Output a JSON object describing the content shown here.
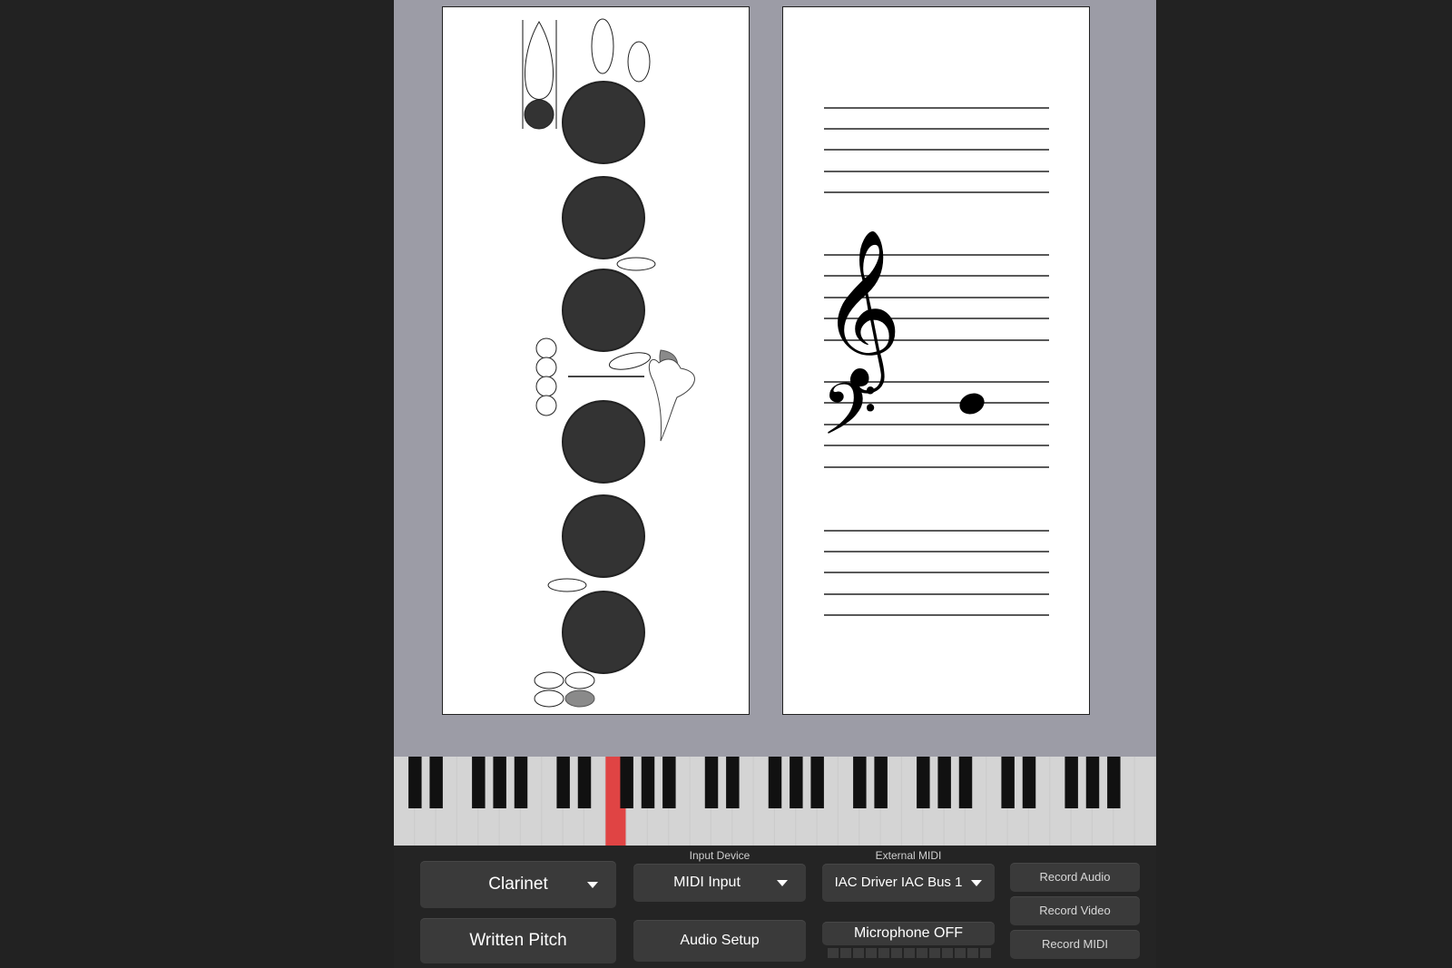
{
  "colors": {
    "app_background": "#9c9ca6",
    "key_fill_closed": "#333333",
    "key_fill_half": "#8a8a8a",
    "active_piano_key": "#e04444",
    "controls_background": "#242424",
    "button_background": "#3a3a3a"
  },
  "fingering": {
    "instrument": "Clarinet",
    "closed_keys": [
      "thumb-hole",
      "hole-1",
      "hole-2",
      "hole-3",
      "hole-4",
      "hole-5",
      "hole-6"
    ],
    "half_keys": [
      "side-key-upper",
      "pinky-key-bottom-right"
    ]
  },
  "staff": {
    "clefs": [
      "treble-clef-icon",
      "bass-clef-icon"
    ],
    "note": "whole-note"
  },
  "keyboard": {
    "active_white_key_index": 10
  },
  "controls": {
    "instrument_select": {
      "value": "Clarinet"
    },
    "pitch_mode_button": {
      "label": "Written Pitch"
    },
    "input_device": {
      "label": "Input Device",
      "value": "MIDI Input"
    },
    "audio_setup_button": {
      "label": "Audio Setup"
    },
    "external_midi": {
      "label": "External MIDI",
      "value": "IAC Driver IAC Bus 1"
    },
    "microphone_button": {
      "label": "Microphone OFF"
    },
    "record_audio_button": {
      "label": "Record Audio"
    },
    "record_video_button": {
      "label": "Record Video"
    },
    "record_midi_button": {
      "label": "Record MIDI"
    }
  }
}
